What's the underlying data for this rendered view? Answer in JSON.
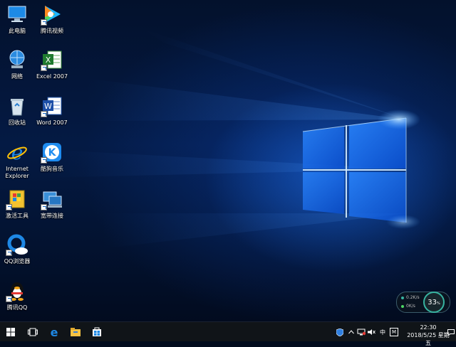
{
  "desktop": {
    "icons": [
      {
        "id": "this-pc",
        "label": "此电脑",
        "icon": "computer-icon"
      },
      {
        "id": "tencent-video",
        "label": "腾讯视频",
        "icon": "tencent-video-icon"
      },
      {
        "id": "network",
        "label": "网络",
        "icon": "network-icon"
      },
      {
        "id": "excel",
        "label": "Excel 2007",
        "icon": "excel-icon"
      },
      {
        "id": "recycle-bin",
        "label": "回收站",
        "icon": "recycle-bin-icon"
      },
      {
        "id": "word",
        "label": "Word 2007",
        "icon": "word-icon"
      },
      {
        "id": "ie",
        "label": "Internet Explorer",
        "icon": "internet-explorer-icon"
      },
      {
        "id": "kugou",
        "label": "酷狗音乐",
        "icon": "kugou-music-icon"
      },
      {
        "id": "activation",
        "label": "激活工具",
        "icon": "activation-tool-icon"
      },
      {
        "id": "broadband",
        "label": "宽带连接",
        "icon": "broadband-icon"
      },
      {
        "id": "qq-browser",
        "label": "QQ浏览器",
        "icon": "qq-browser-icon"
      },
      {
        "id": "tencent-qq",
        "label": "腾讯QQ",
        "icon": "qq-penguin-icon"
      }
    ]
  },
  "net_widget": {
    "upload": "0.2K/s",
    "download": "0K/s",
    "usage_percent": "33",
    "percent_sign": "%"
  },
  "taskbar": {
    "ime_label": "中",
    "ime_mode": "M",
    "time": "22:30",
    "date": "2018/5/25 星期五"
  },
  "colors": {
    "accent": "#1e90ff",
    "taskbar": "#101418",
    "gauge_ring": "#37b3a0"
  }
}
